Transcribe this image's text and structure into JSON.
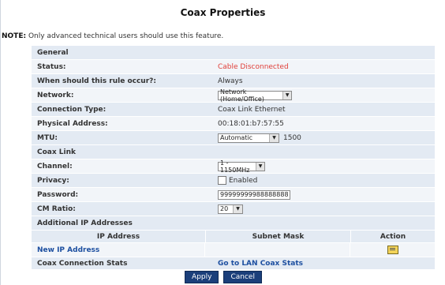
{
  "title": "Coax Properties",
  "note": {
    "prefix": "NOTE:",
    "text": "Only advanced technical users should use this feature."
  },
  "general": {
    "heading": "General",
    "status_label": "Status:",
    "status_value": "Cable Disconnected",
    "rule_label": "When should this rule occur?:",
    "rule_value": "Always",
    "network_label": "Network:",
    "network_value": "Network (Home/Office)",
    "conn_type_label": "Connection Type:",
    "conn_type_value": "Coax Link Ethernet",
    "phys_label": "Physical Address:",
    "phys_value": "00:18:01:b7:57:55",
    "mtu_label": "MTU:",
    "mtu_select": "Automatic",
    "mtu_value": "1500"
  },
  "coax": {
    "heading": "Coax Link",
    "channel_label": "Channel:",
    "channel_value": "1 - 1150MHz",
    "privacy_label": "Privacy:",
    "privacy_checkbox_label": "Enabled",
    "password_label": "Password:",
    "password_value": "99999999988888888",
    "cm_label": "CM Ratio:",
    "cm_value": "20"
  },
  "additional": {
    "heading": "Additional IP Addresses",
    "col_ip": "IP Address",
    "col_mask": "Subnet Mask",
    "col_action": "Action",
    "new_ip": "New IP Address"
  },
  "stats": {
    "label": "Coax Connection Stats",
    "link": "Go to LAN Coax Stats"
  },
  "buttons": {
    "apply": "Apply",
    "cancel": "Cancel"
  }
}
